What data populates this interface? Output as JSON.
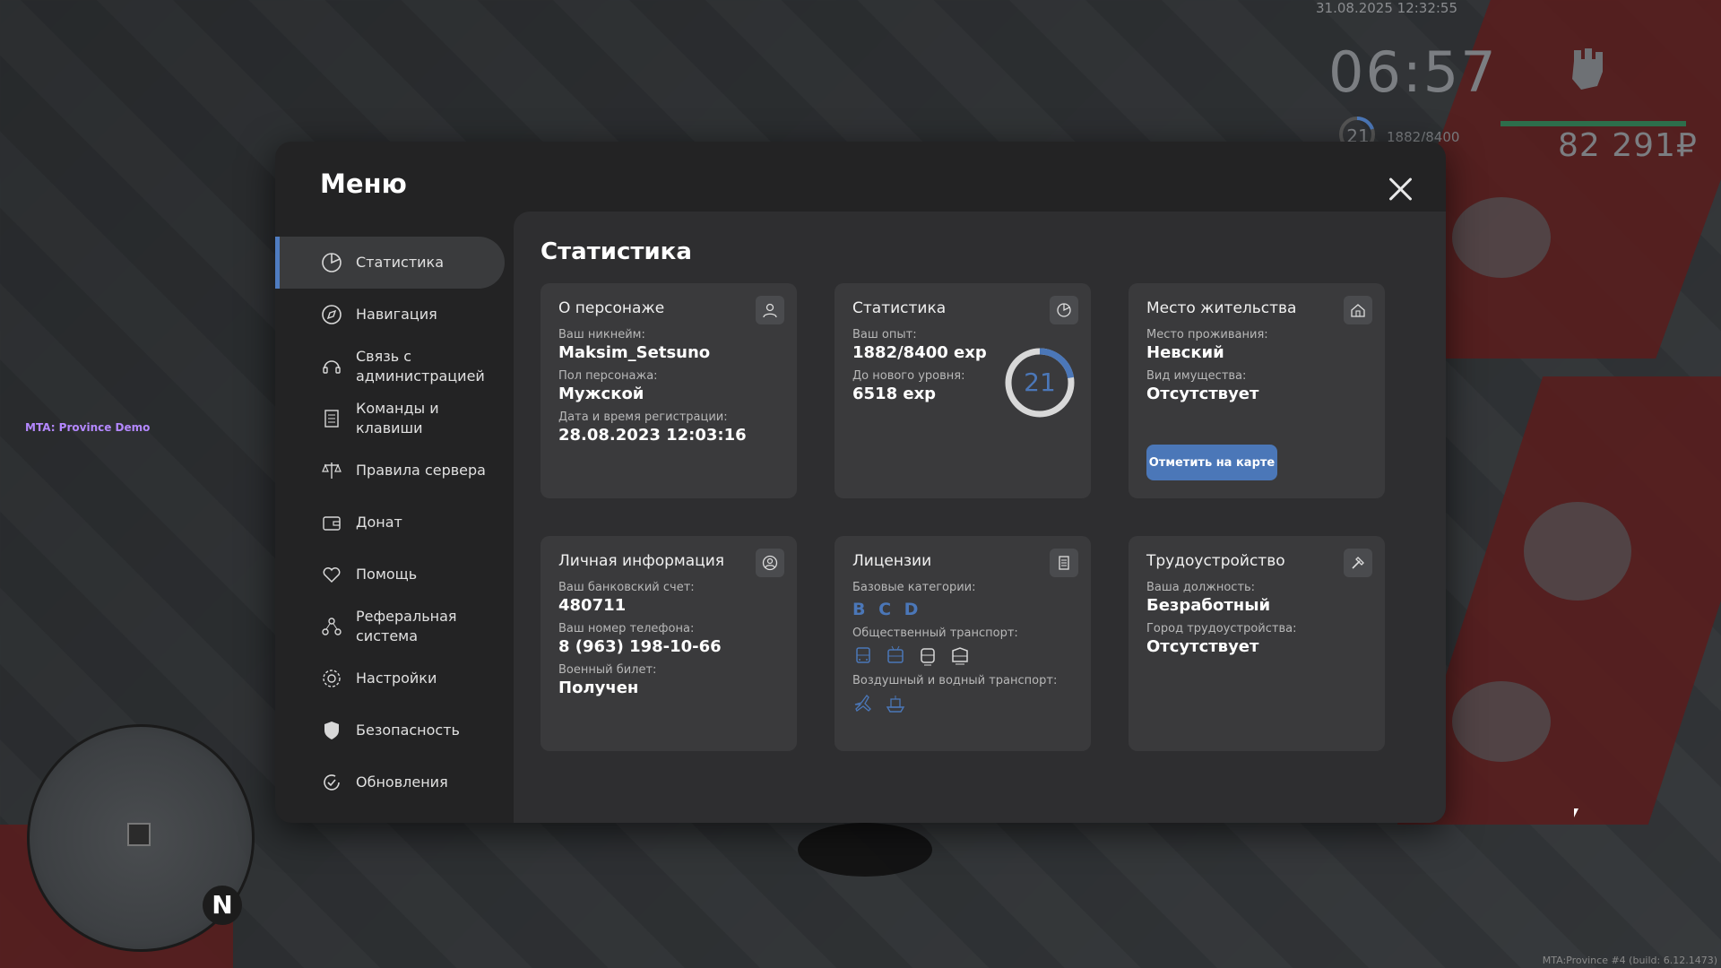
{
  "hud": {
    "datetime": "31.08.2025 12:32:55",
    "time": "06:57",
    "level": "21",
    "exp": "1882/8400",
    "money": "82 291₽",
    "server_tag": "MTA: Province Demo",
    "build": "MTA:Province #4 (build: 6.12.1473)",
    "compass": "N"
  },
  "menu": {
    "title": "Меню",
    "sidebar": [
      {
        "label": "Статистика",
        "icon": "pie-chart-icon",
        "active": true
      },
      {
        "label": "Навигация",
        "icon": "compass-icon"
      },
      {
        "label": "Связь с администрацией",
        "icon": "headset-icon"
      },
      {
        "label": "Команды и клавиши",
        "icon": "document-list-icon"
      },
      {
        "label": "Правила сервера",
        "icon": "scales-icon"
      },
      {
        "label": "Донат",
        "icon": "wallet-icon"
      },
      {
        "label": "Помощь",
        "icon": "heart-hand-icon"
      },
      {
        "label": "Реферальная система",
        "icon": "people-network-icon"
      },
      {
        "label": "Настройки",
        "icon": "gear-icon"
      },
      {
        "label": "Безопасность",
        "icon": "shield-icon"
      },
      {
        "label": "Обновления",
        "icon": "refresh-check-icon"
      }
    ]
  },
  "stats": {
    "title": "Статистика",
    "character": {
      "title": "О персонаже",
      "nick_label": "Ваш никнейм:",
      "nick": "Maksim_Setsuno",
      "gender_label": "Пол персонажа:",
      "gender": "Мужской",
      "reg_label": "Дата и время регистрации:",
      "reg": "28.08.2023 12:03:16"
    },
    "statistics": {
      "title": "Статистика",
      "exp_label": "Ваш опыт:",
      "exp": "1882/8400 exp",
      "next_label": "До нового уровня:",
      "next": "6518 exp",
      "level": "21",
      "progress": 0.224
    },
    "residence": {
      "title": "Место жительства",
      "place_label": "Место проживания:",
      "place": "Невский",
      "property_label": "Вид имущества:",
      "property": "Отсутствует",
      "button": "Отметить на карте"
    },
    "personal": {
      "title": "Личная информация",
      "bank_label": "Ваш банковский счет:",
      "bank": "480711",
      "phone_label": "Ваш номер телефона:",
      "phone": "8 (963) 198-10-66",
      "military_label": "Военный билет:",
      "military": "Получен"
    },
    "licenses": {
      "title": "Лицензии",
      "base_label": "Базовые категории:",
      "base": "B C D",
      "public_label": "Общественный транспорт:",
      "air_label": "Воздушный и водный транспорт:"
    },
    "job": {
      "title": "Трудоустройство",
      "position_label": "Ваша должность:",
      "position": "Безработный",
      "city_label": "Город трудоустройства:",
      "city": "Отсутствует"
    }
  },
  "colors": {
    "accent": "#4b77b8",
    "panel": "#232324",
    "content": "#2e2e30",
    "card": "#3a3a3c"
  }
}
